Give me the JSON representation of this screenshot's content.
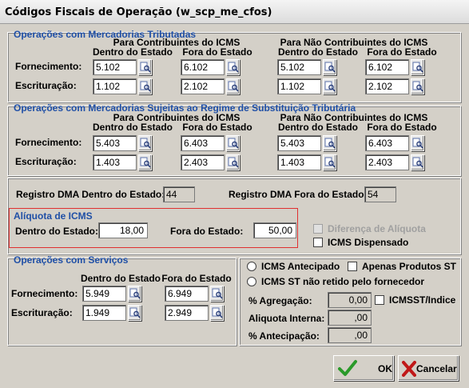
{
  "window": {
    "title": "Códigos Fiscais de Operação (w_scp_me_cfos)"
  },
  "tributadas": {
    "title": "Operações com Mercadorias Tributadas",
    "hdr_contrib": "Para Contribuintes do ICMS",
    "hdr_nao_contrib": "Para Não Contribuintes do ICMS",
    "hdr_dentro": "Dentro do Estado",
    "hdr_fora": "Fora do Estado",
    "row1_label": "Fornecimento:",
    "row2_label": "Escrituração:",
    "forn": [
      "5.102",
      "6.102",
      "5.102",
      "6.102"
    ],
    "escr": [
      "1.102",
      "2.102",
      "1.102",
      "2.102"
    ]
  },
  "substituicao": {
    "title": "Operações com Mercadorias Sujeitas ao Regime de Substituição Tributária",
    "hdr_contrib": "Para Contribuintes do ICMS",
    "hdr_nao_contrib": "Para Não Contribuintes do ICMS",
    "hdr_dentro": "Dentro do Estado",
    "hdr_fora": "Fora do Estado",
    "row1_label": "Fornecimento:",
    "row2_label": "Escrituração:",
    "forn": [
      "5.403",
      "6.403",
      "5.403",
      "6.403"
    ],
    "escr": [
      "1.403",
      "2.403",
      "1.403",
      "2.403"
    ]
  },
  "dma": {
    "dentro_label": "Registro DMA Dentro do Estado:",
    "dentro_value": "44",
    "fora_label": "Registro DMA Fora do Estado:",
    "fora_value": "54"
  },
  "aliquota": {
    "title": "Alíquota de ICMS",
    "dentro_label": "Dentro do Estado:",
    "dentro_value": "18,00",
    "fora_label": "Fora do Estado:",
    "fora_value": "50,00",
    "border_color": "#e03030"
  },
  "options": {
    "diferenca_label": "Diferença de Alíquota",
    "dispensado_label": "ICMS Dispensado"
  },
  "servicos": {
    "title": "Operações com Serviços",
    "hdr_dentro": "Dentro do Estado",
    "hdr_fora": "Fora do Estado",
    "row1_label": "Fornecimento:",
    "row2_label": "Escrituração:",
    "forn": [
      "5.949",
      "6.949"
    ],
    "escr": [
      "1.949",
      "2.949"
    ]
  },
  "st": {
    "antecipado_label": "ICMS Antecipado",
    "apenas_label": "Apenas Produtos ST",
    "nao_retido_label": "ICMS ST não retido pelo fornecedor",
    "agregacao_label": "% Agregação:",
    "agregacao_value": "0,00",
    "icmsst_label": "ICMSST/Indice",
    "aliq_interna_label": "Aliquota Interna:",
    "aliq_interna_value": ",00",
    "antecipacao_label": "% Antecipação:",
    "antecipacao_value": ",00"
  },
  "buttons": {
    "ok_label": "OK",
    "cancel_label": "Cancelar"
  },
  "colors": {
    "section_title": "#1f4fa6",
    "ok_icon": "#2a9a2a",
    "cancel_icon": "#c01818"
  },
  "icons": {
    "lookup": "lookup-icon",
    "ok": "checkmark-icon",
    "cancel": "x-icon"
  }
}
